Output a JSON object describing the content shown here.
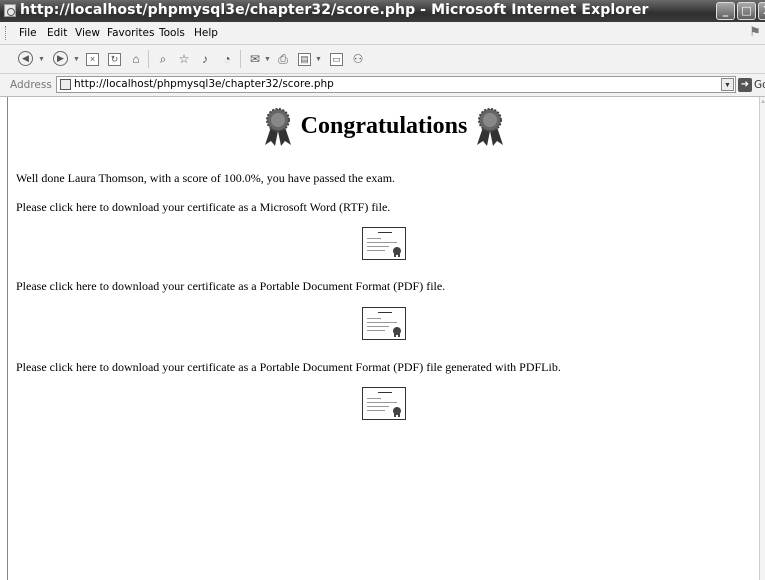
{
  "window": {
    "title": "http://localhost/phpmysql3e/chapter32/score.php - Microsoft Internet Explorer",
    "buttons": {
      "minimize": "_",
      "maximize": "□",
      "close": "X"
    }
  },
  "menu": [
    "File",
    "Edit",
    "View",
    "Favorites",
    "Tools",
    "Help"
  ],
  "toolbar": {
    "icons": [
      "back-icon",
      "forward-icon",
      "stop-icon",
      "refresh-icon",
      "home-icon",
      "search-icon",
      "favorites-icon",
      "media-icon",
      "history-icon",
      "mail-icon",
      "print-icon",
      "edit-icon",
      "discuss-icon",
      "messenger-icon"
    ]
  },
  "address": {
    "label": "Address",
    "url": "http://localhost/phpmysql3e/chapter32/score.php",
    "go_label": "Go"
  },
  "page": {
    "heading": "Congratulations",
    "score_text": "Well done Laura Thomson, with a score of 100.0%, you have passed the exam.",
    "links": [
      {
        "text": "Please click here to download your certificate as a Microsoft Word (RTF) file."
      },
      {
        "text": "Please click here to download your certificate as a Portable Document Format (PDF) file."
      },
      {
        "text": "Please click here to download your certificate as a Portable Document Format (PDF) file generated with PDFLib."
      }
    ]
  }
}
